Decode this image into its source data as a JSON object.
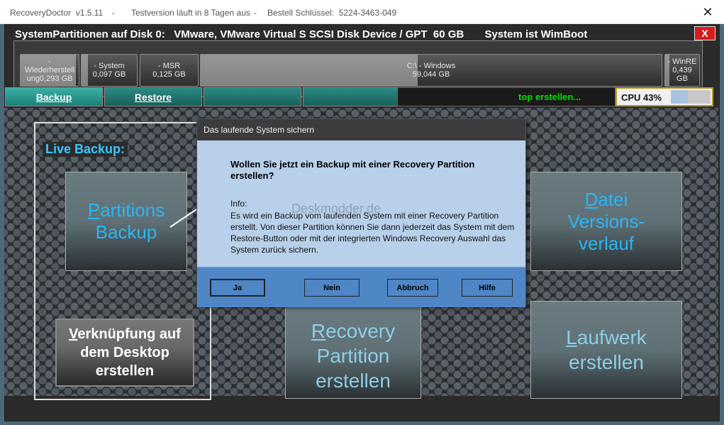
{
  "window": {
    "app_name": "RecoveryDoctor  v1.5.11",
    "sep1": "-",
    "trial": "Testversion läuft in 8 Tagen aus",
    "sep2": "-",
    "serial": "Bestell Schlüssel:  5224-3463-049",
    "close_glyph": "✕"
  },
  "diskbar": {
    "title": "SystemPartitionen auf Disk 0:   VMware, VMware Virtual S SCSI Disk Device / GPT  60 GB       System ist WimBoot",
    "close_label": "X",
    "partitions": [
      {
        "line1": "-",
        "line2": "Wiederherstell",
        "line3": "ung0,293 GB",
        "used": 0.95
      },
      {
        "line1": "- System",
        "line2": "0,097 GB",
        "line3": "",
        "used": 0.12
      },
      {
        "line1": "- MSR",
        "line2": "0,125 GB",
        "line3": "",
        "used": 0.0
      },
      {
        "line1": "C:\\ - Windows",
        "line2": "59,044 GB",
        "line3": "",
        "used": 0.47
      },
      {
        "line1": "- WinRE",
        "line2": "0,439",
        "line3": "GB",
        "used": 0.12
      }
    ]
  },
  "tabs": [
    {
      "label": "Backup"
    },
    {
      "label": "Restore"
    },
    {
      "label": ""
    },
    {
      "label": ""
    }
  ],
  "status_text": "top erstellen...",
  "cpu": {
    "label": "CPU 43%",
    "value": 0.43
  },
  "live_backup_label": "Live Backup:",
  "tiles": {
    "partitions_backup": {
      "first": "P",
      "rest1": "artitions",
      "line2": "Backup"
    },
    "datei": {
      "first": "D",
      "rest1": "atei",
      "line2": "Versions-",
      "line3": "verlauf"
    },
    "verknuepfung": {
      "first": "V",
      "rest1": "erknüpfung auf",
      "line2": "dem Desktop",
      "line3": "erstellen"
    },
    "recovery": {
      "first": "R",
      "rest1": "ecovery",
      "line2": "Partition",
      "line3": "erstellen"
    },
    "laufwerk": {
      "first": "L",
      "rest1": "aufwerk",
      "line2": "erstellen"
    }
  },
  "dialog": {
    "title": "Das laufende System sichern",
    "question": "Wollen Sie jetzt ein Backup mit einer Recovery Partition erstellen?",
    "info_title": "Info:",
    "info_text": "Es wird ein Backup vom laufenden System mit einer Recovery Partition erstellt. Von dieser Partition können Sie dann jederzeit das System mit dem Restore-Button oder mit der integrierten Windows Recovery Auswahl das System zurück sichern.",
    "watermark": "Deskmodder.de",
    "buttons": {
      "yes": "Ja",
      "no": "Nein",
      "cancel": "Abbruch",
      "help": "Hilfe"
    }
  },
  "colors": {
    "accent_cyan": "#29b6f6",
    "tab_teal": "#2a9d94",
    "status_green": "#00e000",
    "dialog_footer": "#4f86c6"
  }
}
